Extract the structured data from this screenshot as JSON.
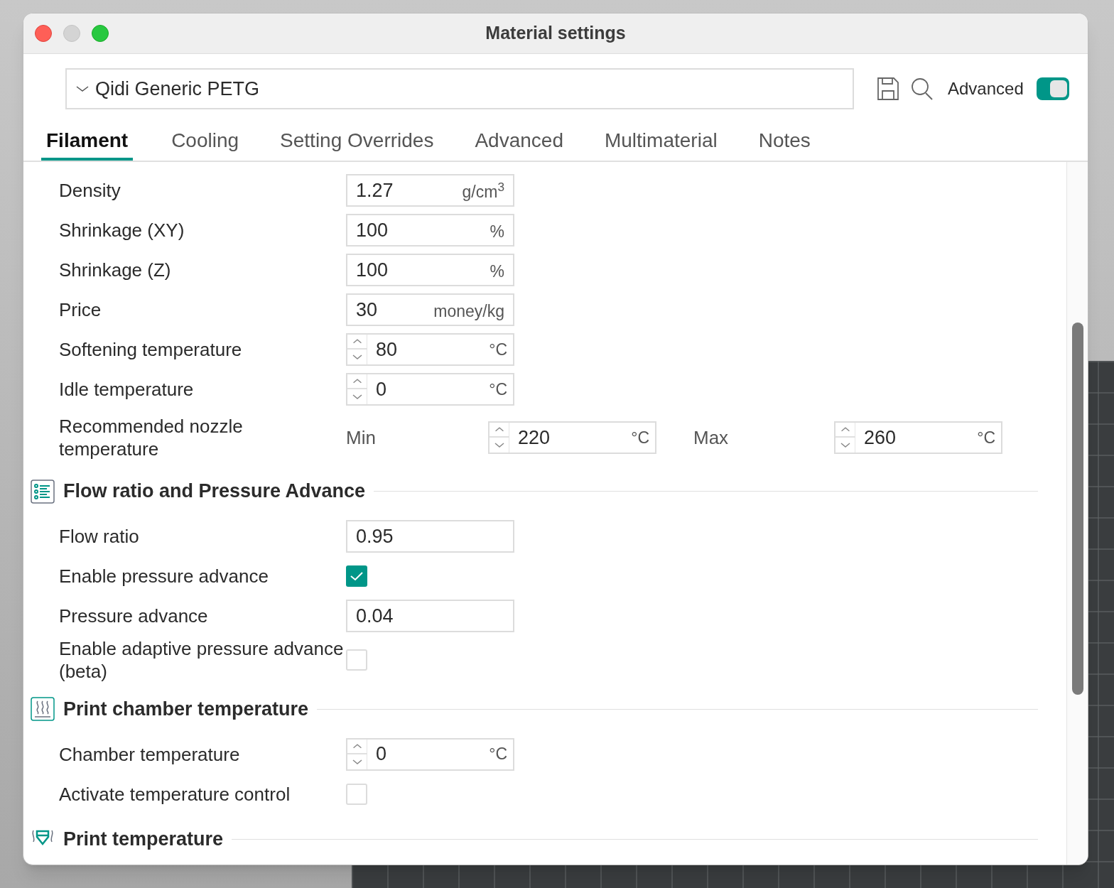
{
  "window": {
    "title": "Material settings"
  },
  "preset": {
    "value": "Qidi Generic PETG"
  },
  "advanced": {
    "label": "Advanced",
    "on": true
  },
  "tabs": [
    {
      "label": "Filament",
      "selected": true
    },
    {
      "label": "Cooling",
      "selected": false
    },
    {
      "label": "Setting Overrides",
      "selected": false
    },
    {
      "label": "Advanced",
      "selected": false
    },
    {
      "label": "Multimaterial",
      "selected": false
    },
    {
      "label": "Notes",
      "selected": false
    }
  ],
  "rows": [
    {
      "kind": "field",
      "label": "Density",
      "value": "1.27",
      "unit": "g/cm$^{3}$"
    },
    {
      "kind": "field",
      "label": "Shrinkage (XY)",
      "value": "100",
      "unit": "%"
    },
    {
      "kind": "field",
      "label": "Shrinkage (Z)",
      "value": "100",
      "unit": "%"
    },
    {
      "kind": "field",
      "label": "Price",
      "value": "30",
      "unit": "money/kg"
    },
    {
      "kind": "spin",
      "label": "Softening temperature",
      "value": "80",
      "unit": "°C"
    },
    {
      "kind": "spin",
      "label": "Idle temperature",
      "value": "0",
      "unit": "°C"
    },
    {
      "kind": "range",
      "label": "Recommended nozzle temperature",
      "min_label": "Min",
      "min": "220",
      "min_unit": "°C",
      "max_label": "Max",
      "max": "260",
      "max_unit": "°C"
    },
    {
      "kind": "section",
      "title": "Flow ratio and Pressure Advance"
    },
    {
      "kind": "field",
      "label": "Flow ratio",
      "value": "0.95"
    },
    {
      "kind": "checkbox",
      "label": "Enable pressure advance",
      "checked": true
    },
    {
      "kind": "field",
      "label": "Pressure advance",
      "value": "0.04"
    },
    {
      "kind": "checkbox",
      "label": "Enable adaptive pressure advance (beta)",
      "checked": false
    },
    {
      "kind": "section",
      "title": "Print chamber temperature"
    },
    {
      "kind": "spin",
      "label": "Chamber temperature",
      "value": "0",
      "unit": "°C"
    },
    {
      "kind": "checkbox",
      "label": "Activate temperature control",
      "checked": false
    },
    {
      "kind": "section",
      "title": "Print temperature"
    }
  ]
}
